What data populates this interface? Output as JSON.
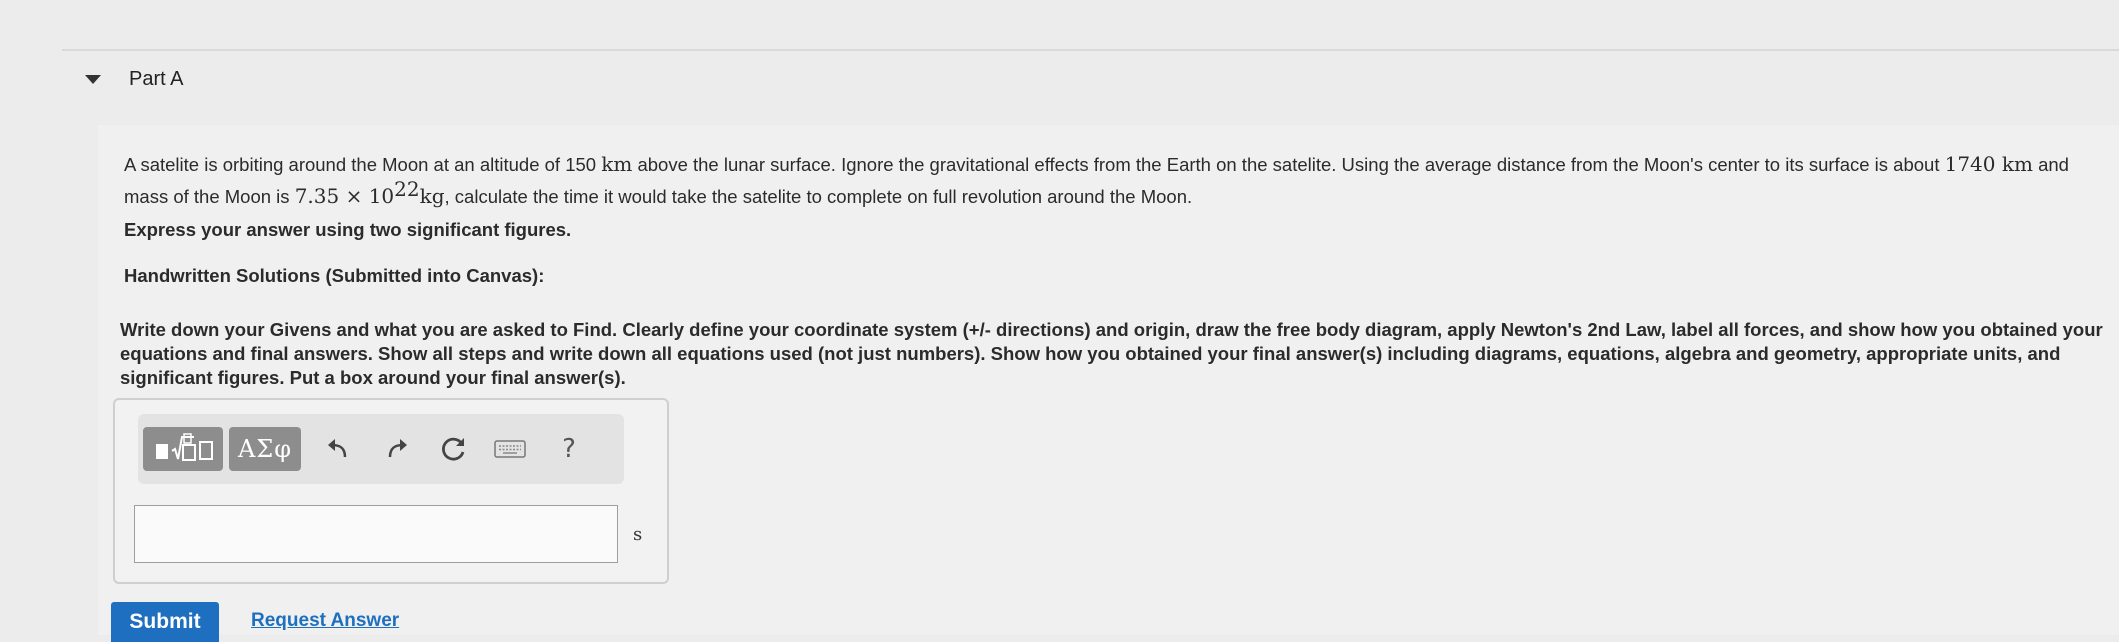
{
  "part": {
    "title": "Part A"
  },
  "problem": {
    "seg1": "A satelite is orbiting around the Moon at an altitude of 150 ",
    "unit_km1": "km",
    "seg2": " above the lunar surface.  Ignore the gravitational effects from the Earth on the satelite. Using the average distance from the Moon's center to its surface is about ",
    "val_radius": "1740 ",
    "unit_km2": "km",
    "seg3": " and mass of the Moon is ",
    "mass_mantissa": "7.35 × 10",
    "mass_exp": "22",
    "mass_unit": "kg",
    "seg4": ", calculate the time it would take the satelite to complete on full revolution around the Moon."
  },
  "sigfig_instruction": "Express your answer using two significant figures.",
  "handwritten_heading": "Handwritten Solutions (Submitted into Canvas):",
  "instructions": "Write down your Givens and what you are asked to Find.  Clearly define your coordinate system (+/- directions) and origin, draw the free body diagram, apply Newton's 2nd Law, label all forces, and show how you obtained your equations and final answers.  Show all steps and write down all equations used (not just numbers).  Show how you obtained your final answer(s) including diagrams, equations, algebra and geometry, appropriate units, and significant figures.  Put a box around your final answer(s).",
  "toolbar": {
    "symbols_label": "ΑΣφ",
    "help_label": "?"
  },
  "answer": {
    "value": "",
    "unit": "s"
  },
  "buttons": {
    "submit": "Submit",
    "request_answer": "Request Answer"
  },
  "colors": {
    "accent": "#1e6fbf",
    "toolbar_button": "#8d8d8d"
  }
}
